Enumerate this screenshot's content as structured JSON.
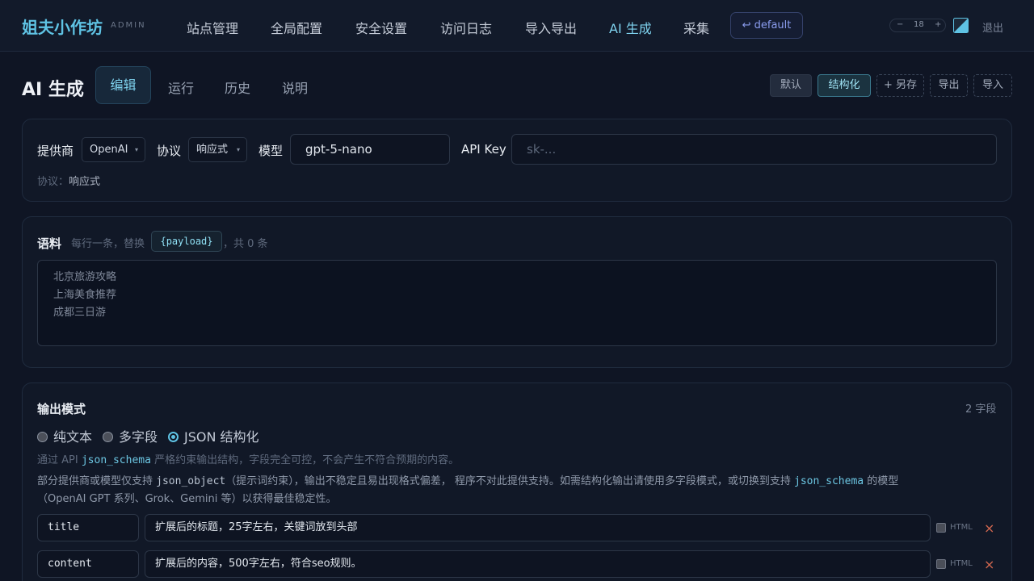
{
  "brand": {
    "name": "姐夫小作坊",
    "sub": "ADMIN"
  },
  "nav": {
    "items": [
      "站点管理",
      "全局配置",
      "安全设置",
      "访问日志",
      "导入导出",
      "AI 生成",
      "采集"
    ],
    "active": "AI 生成",
    "site": "↩ default",
    "zoom": {
      "minus": "−",
      "value": "18",
      "plus": "+"
    },
    "logout": "退出"
  },
  "page": {
    "title": "AI 生成",
    "tabs": [
      "编辑",
      "运行",
      "历史",
      "说明"
    ],
    "active_tab": "编辑",
    "actions": {
      "default": "默认",
      "structured": "结构化",
      "save_as": "+ 另存",
      "export": "导出",
      "import": "导入"
    }
  },
  "provider": {
    "provider_label": "提供商",
    "provider_value": "OpenAI",
    "protocol_label": "协议",
    "protocol_value": "响应式",
    "model_label": "模型",
    "model_value": "gpt-5-nano",
    "apikey_label": "API Key",
    "apikey_placeholder": "sk-...",
    "protocol_hint_label": "协议：",
    "protocol_hint_value": "响应式"
  },
  "corpus": {
    "title": "语料",
    "hint_prefix": "每行一条，替换",
    "hint_token": "{payload}",
    "hint_suffix": "，共 0 条",
    "placeholder_lines": [
      "北京旅游攻略",
      "上海美食推荐",
      "成都三日游"
    ]
  },
  "output": {
    "title": "输出模式",
    "count": "2 字段",
    "modes": [
      "纯文本",
      "多字段",
      "JSON 结构化"
    ],
    "selected_mode": "JSON 结构化",
    "desc1_prefix": "通过 API ",
    "desc1_code": "json_schema",
    "desc1_suffix": " 严格约束输出结构，字段完全可控，不会产生不符合预期的内容。",
    "desc2_prefix": "部分提供商或模型仅支持 ",
    "desc2_code1": "json_object",
    "desc2_mid": "（提示词约束），输出不稳定且易出现格式偏差， 程序不对此提供支持。如需结构化输出请使用多字段模式，或切换到支持 ",
    "desc2_code2": "json_schema",
    "desc2_suffix": " 的模型",
    "desc3": "（OpenAI GPT 系列、Grok、Gemini 等）以获得最佳稳定性。",
    "fields": [
      {
        "key": "title",
        "desc": "扩展后的标题，25字左右，关键词放到头部",
        "html_label": "HTML",
        "html": false
      },
      {
        "key": "content",
        "desc": "扩展后的内容，500字左右，符合seo规则。",
        "html_label": "HTML",
        "html": false
      }
    ],
    "delete_glyph": "×"
  },
  "colors": {
    "accent": "#5fc3e4",
    "background": "#0f1524",
    "danger": "#d2674f"
  }
}
